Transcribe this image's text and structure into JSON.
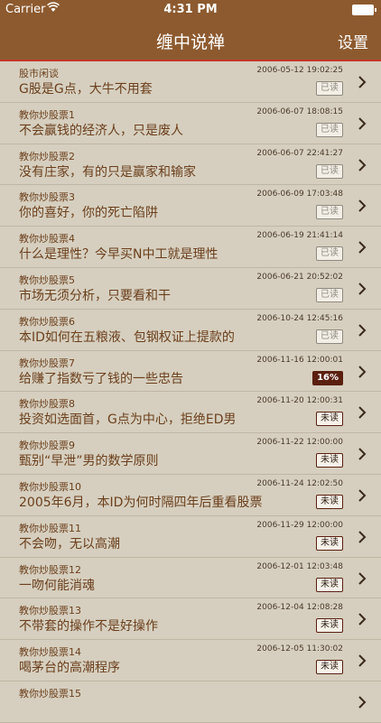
{
  "status": {
    "carrier": "Carrier",
    "time": "4:31 PM"
  },
  "nav": {
    "title": "缠中说禅",
    "settings": "设置"
  },
  "rows": [
    {
      "cat": "股市闲谈",
      "date": "2006-05-12 19:02:25",
      "title": "G股是G点，大牛不用套",
      "badge": "已读",
      "type": "read"
    },
    {
      "cat": "教你炒股票1",
      "date": "2006-06-07 18:08:15",
      "title": "不会赢钱的经济人，只是废人",
      "badge": "已读",
      "type": "read"
    },
    {
      "cat": "教你炒股票2",
      "date": "2006-06-07 22:41:27",
      "title": "没有庄家，有的只是赢家和输家",
      "badge": "已读",
      "type": "read"
    },
    {
      "cat": "教你炒股票3",
      "date": "2006-06-09 17:03:48",
      "title": "你的喜好，你的死亡陷阱",
      "badge": "已读",
      "type": "read"
    },
    {
      "cat": "教你炒股票4",
      "date": "2006-06-19 21:41:14",
      "title": "什么是理性？今早买N中工就是理性",
      "badge": "已读",
      "type": "read"
    },
    {
      "cat": "教你炒股票5",
      "date": "2006-06-21 20:52:02",
      "title": "市场无须分析，只要看和干",
      "badge": "已读",
      "type": "read"
    },
    {
      "cat": "教你炒股票6",
      "date": "2006-10-24 12:45:16",
      "title": "本ID如何在五粮液、包钢权证上提款的",
      "badge": "已读",
      "type": "read"
    },
    {
      "cat": "教你炒股票7",
      "date": "2006-11-16 12:00:01",
      "title": "给赚了指数亏了钱的一些忠告",
      "badge": "16%",
      "type": "progress"
    },
    {
      "cat": "教你炒股票8",
      "date": "2006-11-20 12:00:31",
      "title": "投资如选面首，G点为中心，拒绝ED男",
      "badge": "未读",
      "type": "unread"
    },
    {
      "cat": "教你炒股票9",
      "date": "2006-11-22 12:00:00",
      "title": "甄别“早泄”男的数学原则",
      "badge": "未读",
      "type": "unread"
    },
    {
      "cat": "教你炒股票10",
      "date": "2006-11-24 12:02:50",
      "title": "2005年6月，本ID为何时隔四年后重看股票",
      "badge": "未读",
      "type": "unread"
    },
    {
      "cat": "教你炒股票11",
      "date": "2006-11-29 12:00:00",
      "title": "不会吻，无以高潮",
      "badge": "未读",
      "type": "unread"
    },
    {
      "cat": "教你炒股票12",
      "date": "2006-12-01 12:03:48",
      "title": "一吻何能消魂",
      "badge": "未读",
      "type": "unread"
    },
    {
      "cat": "教你炒股票13",
      "date": "2006-12-04 12:08:28",
      "title": "不带套的操作不是好操作",
      "badge": "未读",
      "type": "unread"
    },
    {
      "cat": "教你炒股票14",
      "date": "2006-12-05 11:30:02",
      "title": "喝茅台的高潮程序",
      "badge": "未读",
      "type": "unread"
    },
    {
      "cat": "教你炒股票15",
      "date": "",
      "title": "",
      "badge": "",
      "type": "unread"
    }
  ]
}
